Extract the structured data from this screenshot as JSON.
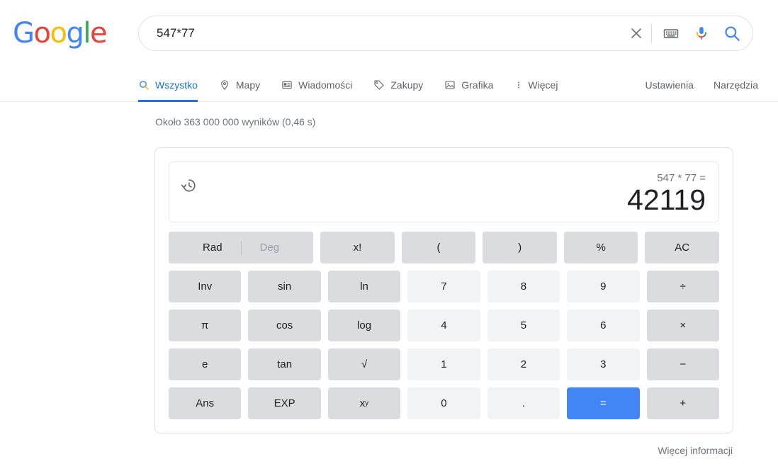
{
  "header": {
    "logo": {
      "letters": [
        {
          "ch": "G",
          "color": "#4285f4"
        },
        {
          "ch": "o",
          "color": "#ea4335"
        },
        {
          "ch": "o",
          "color": "#fbbc05"
        },
        {
          "ch": "g",
          "color": "#4285f4"
        },
        {
          "ch": "l",
          "color": "#34a853"
        },
        {
          "ch": "e",
          "color": "#ea4335"
        }
      ],
      "name": "google-logo"
    },
    "search": {
      "value": "547*77",
      "placeholder": "",
      "clear_icon": "close-icon",
      "keyboard_icon": "keyboard-icon",
      "mic_icon": "microphone-icon",
      "search_icon": "search-icon"
    }
  },
  "nav": {
    "tabs": [
      {
        "label": "Wszystko",
        "icon": "search-icon",
        "active": true
      },
      {
        "label": "Mapy",
        "icon": "map-pin-icon",
        "active": false
      },
      {
        "label": "Wiadomości",
        "icon": "news-icon",
        "active": false
      },
      {
        "label": "Zakupy",
        "icon": "tag-icon",
        "active": false
      },
      {
        "label": "Grafika",
        "icon": "image-icon",
        "active": false
      },
      {
        "label": "Więcej",
        "icon": "more-vertical-icon",
        "active": false
      }
    ],
    "right_items": [
      {
        "label": "Ustawienia"
      },
      {
        "label": "Narzędzia"
      }
    ]
  },
  "results": {
    "count_text": "Około 363 000 000 wyników (0,46 s)",
    "more_info": "Więcej informacji",
    "bottom_result_text": "........."
  },
  "calculator": {
    "history_icon": "history-icon",
    "expression": "547 * 77 =",
    "result": "42119",
    "angle": {
      "rad": "Rad",
      "deg": "Deg",
      "selected": "Rad"
    },
    "rows": [
      [
        {
          "label": "x!",
          "type": "func"
        },
        {
          "label": "(",
          "type": "func"
        },
        {
          "label": ")",
          "type": "func"
        },
        {
          "label": "%",
          "type": "func"
        },
        {
          "label": "AC",
          "type": "func"
        }
      ],
      [
        {
          "label": "Inv",
          "type": "func"
        },
        {
          "label": "sin",
          "type": "func"
        },
        {
          "label": "ln",
          "type": "func"
        },
        {
          "label": "7",
          "type": "digit"
        },
        {
          "label": "8",
          "type": "digit"
        },
        {
          "label": "9",
          "type": "digit"
        },
        {
          "label": "÷",
          "type": "func"
        }
      ],
      [
        {
          "label": "π",
          "type": "func"
        },
        {
          "label": "cos",
          "type": "func"
        },
        {
          "label": "log",
          "type": "func"
        },
        {
          "label": "4",
          "type": "digit"
        },
        {
          "label": "5",
          "type": "digit"
        },
        {
          "label": "6",
          "type": "digit"
        },
        {
          "label": "×",
          "type": "func"
        }
      ],
      [
        {
          "label": "e",
          "type": "func"
        },
        {
          "label": "tan",
          "type": "func"
        },
        {
          "label": "√",
          "type": "func"
        },
        {
          "label": "1",
          "type": "digit"
        },
        {
          "label": "2",
          "type": "digit"
        },
        {
          "label": "3",
          "type": "digit"
        },
        {
          "label": "−",
          "type": "func"
        }
      ],
      [
        {
          "label": "Ans",
          "type": "func"
        },
        {
          "label": "EXP",
          "type": "func"
        },
        {
          "label": "xy",
          "type": "func",
          "sup": "y",
          "base": "x"
        },
        {
          "label": "0",
          "type": "digit"
        },
        {
          "label": ".",
          "type": "digit"
        },
        {
          "label": "=",
          "type": "equals"
        },
        {
          "label": "+",
          "type": "func"
        }
      ]
    ]
  },
  "colors": {
    "google_blue": "#4285f4",
    "link_blue": "#1a73e8",
    "key_func": "#dadce0",
    "key_digit": "#f1f3f4",
    "equals": "#4285f4"
  }
}
